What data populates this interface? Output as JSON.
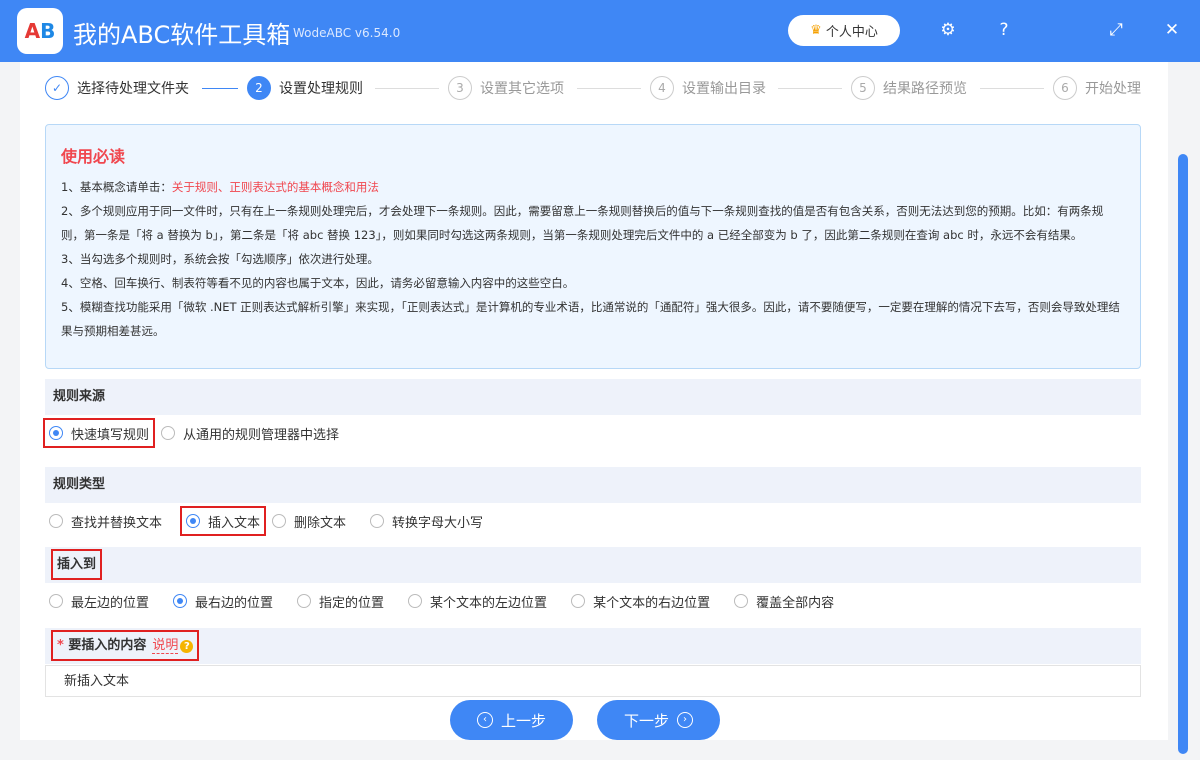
{
  "app": {
    "title": "我的ABC软件工具箱",
    "version": "WodeABC v6.54.0",
    "user_center": "个人中心",
    "logo_text": "AB"
  },
  "steps": [
    {
      "num": "✓",
      "label": "选择待处理文件夹",
      "state": "done"
    },
    {
      "num": "2",
      "label": "设置处理规则",
      "state": "current"
    },
    {
      "num": "3",
      "label": "设置其它选项",
      "state": "todo"
    },
    {
      "num": "4",
      "label": "设置输出目录",
      "state": "todo"
    },
    {
      "num": "5",
      "label": "结果路径预览",
      "state": "todo"
    },
    {
      "num": "6",
      "label": "开始处理",
      "state": "todo"
    }
  ],
  "notice": {
    "title": "使用必读",
    "l1_prefix": "1、基本概念请单击：",
    "l1_link": "关于规则、正则表达式的基本概念和用法",
    "l2": "2、多个规则应用于同一文件时，只有在上一条规则处理完后，才会处理下一条规则。因此，需要留意上一条规则替换后的值与下一条规则查找的值是否有包含关系，否则无法达到您的预期。比如：有两条规则，第一条是「将 a 替换为 b」，第二条是「将 abc 替换 123」，则如果同时勾选这两条规则，当第一条规则处理完后文件中的 a 已经全部变为 b 了，因此第二条规则在查询 abc 时，永远不会有结果。",
    "l3": "3、当勾选多个规则时，系统会按「勾选顺序」依次进行处理。",
    "l4": "4、空格、回车换行、制表符等看不见的内容也属于文本，因此，请务必留意输入内容中的这些空白。",
    "l5": "5、模糊查找功能采用「微软 .NET 正则表达式解析引擎」来实现，「正则表达式」是计算机的专业术语，比通常说的「通配符」强大很多。因此，请不要随便写，一定要在理解的情况下去写，否则会导致处理结果与预期相差甚远。"
  },
  "rule_source": {
    "title": "规则来源",
    "options": [
      "快速填写规则",
      "从通用的规则管理器中选择"
    ],
    "selected": 0
  },
  "rule_type": {
    "title": "规则类型",
    "options": [
      "查找并替换文本",
      "插入文本",
      "删除文本",
      "转换字母大小写"
    ],
    "selected": 1
  },
  "insert_to": {
    "title": "插入到",
    "options": [
      "最左边的位置",
      "最右边的位置",
      "指定的位置",
      "某个文本的左边位置",
      "某个文本的右边位置",
      "覆盖全部内容"
    ],
    "selected": 1
  },
  "content": {
    "required_mark": "*",
    "title": "要插入的内容",
    "explain": "说明",
    "help": "?",
    "value": "新插入文本"
  },
  "nav": {
    "prev": "上一步",
    "next": "下一步"
  },
  "colors": {
    "primary": "#3f87f5",
    "warning": "#f0474f"
  }
}
